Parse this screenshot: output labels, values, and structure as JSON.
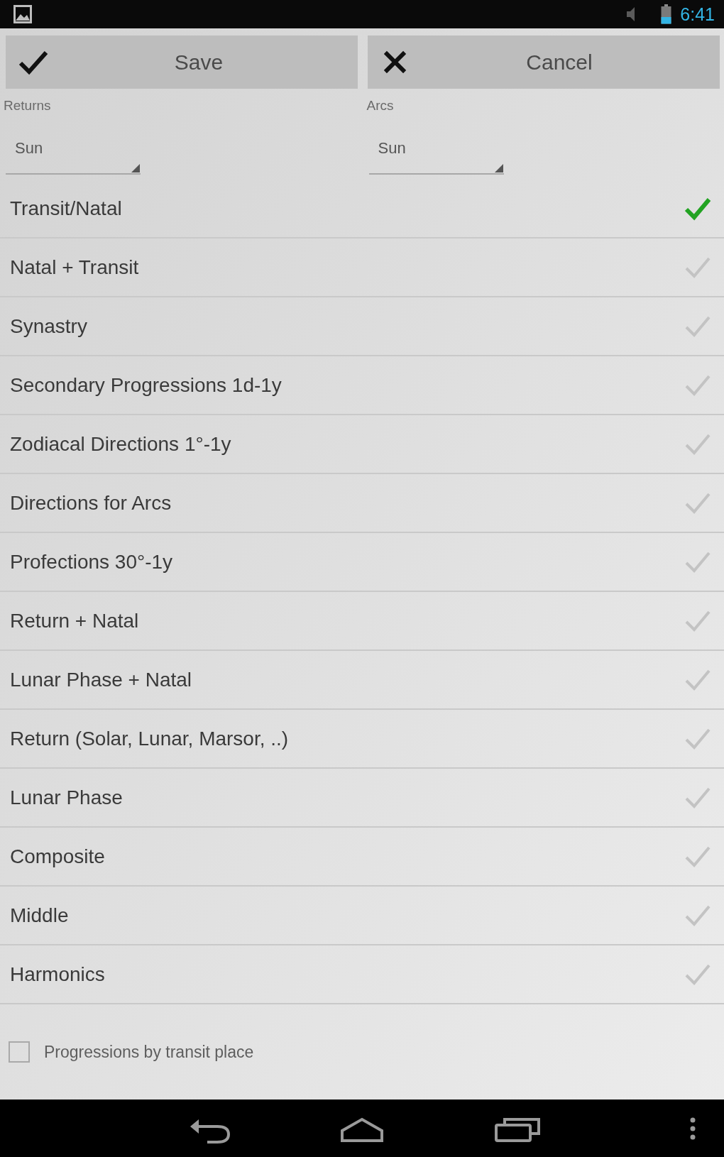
{
  "status_bar": {
    "time": "6:41"
  },
  "actions": [
    {
      "kind": "save",
      "label": "Save"
    },
    {
      "kind": "cancel",
      "label": "Cancel"
    }
  ],
  "pickers": [
    {
      "label": "Returns",
      "value": "Sun"
    },
    {
      "label": "Arcs",
      "value": "Sun"
    }
  ],
  "chart_types": [
    {
      "label": "Transit/Natal",
      "selected": true
    },
    {
      "label": "Natal + Transit",
      "selected": false
    },
    {
      "label": "Synastry",
      "selected": false
    },
    {
      "label": "Secondary Progressions 1d-1y",
      "selected": false
    },
    {
      "label": "Zodiacal Directions 1°-1y",
      "selected": false
    },
    {
      "label": "Directions for Arcs",
      "selected": false
    },
    {
      "label": "Profections 30°-1y",
      "selected": false
    },
    {
      "label": "Return + Natal",
      "selected": false
    },
    {
      "label": "Lunar Phase + Natal",
      "selected": false
    },
    {
      "label": "Return (Solar, Lunar, Marsor, ..)",
      "selected": false
    },
    {
      "label": "Lunar Phase",
      "selected": false
    },
    {
      "label": "Composite",
      "selected": false
    },
    {
      "label": "Middle",
      "selected": false
    },
    {
      "label": "Harmonics",
      "selected": false
    }
  ],
  "options": [
    {
      "label": "Progressions by transit place",
      "checked": false
    }
  ]
}
